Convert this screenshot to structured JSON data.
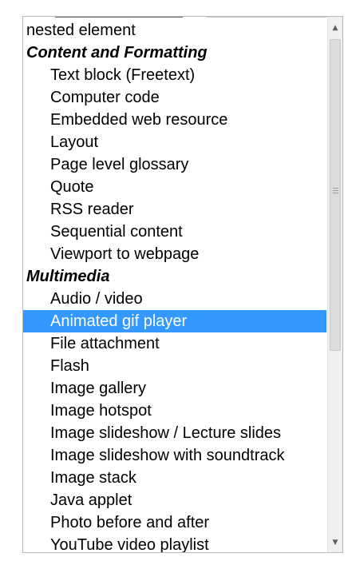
{
  "listbox": {
    "items": [
      {
        "label": "nested element",
        "kind": "first"
      },
      {
        "label": "Content and Formatting",
        "kind": "group"
      },
      {
        "label": "Text block (Freetext)",
        "kind": "child"
      },
      {
        "label": "Computer code",
        "kind": "child"
      },
      {
        "label": "Embedded web resource",
        "kind": "child"
      },
      {
        "label": "Layout",
        "kind": "child"
      },
      {
        "label": "Page level glossary",
        "kind": "child"
      },
      {
        "label": "Quote",
        "kind": "child"
      },
      {
        "label": "RSS reader",
        "kind": "child"
      },
      {
        "label": "Sequential content",
        "kind": "child"
      },
      {
        "label": "Viewport to webpage",
        "kind": "child"
      },
      {
        "label": "Multimedia",
        "kind": "group"
      },
      {
        "label": "Audio / video",
        "kind": "child"
      },
      {
        "label": "Animated gif player",
        "kind": "child",
        "selected": true
      },
      {
        "label": "File attachment",
        "kind": "child"
      },
      {
        "label": "Flash",
        "kind": "child"
      },
      {
        "label": "Image gallery",
        "kind": "child"
      },
      {
        "label": "Image hotspot",
        "kind": "child"
      },
      {
        "label": "Image slideshow / Lecture slides",
        "kind": "child"
      },
      {
        "label": "Image slideshow with soundtrack",
        "kind": "child"
      },
      {
        "label": "Image stack",
        "kind": "child"
      },
      {
        "label": "Java applet",
        "kind": "child"
      },
      {
        "label": "Photo before and after",
        "kind": "child"
      },
      {
        "label": "YouTube video playlist",
        "kind": "child"
      }
    ],
    "scroll_up_icon": "triangle-up-icon",
    "scroll_down_icon": "triangle-down-icon"
  },
  "colors": {
    "selection": "#3399ff",
    "selection_text": "#ffffff"
  }
}
